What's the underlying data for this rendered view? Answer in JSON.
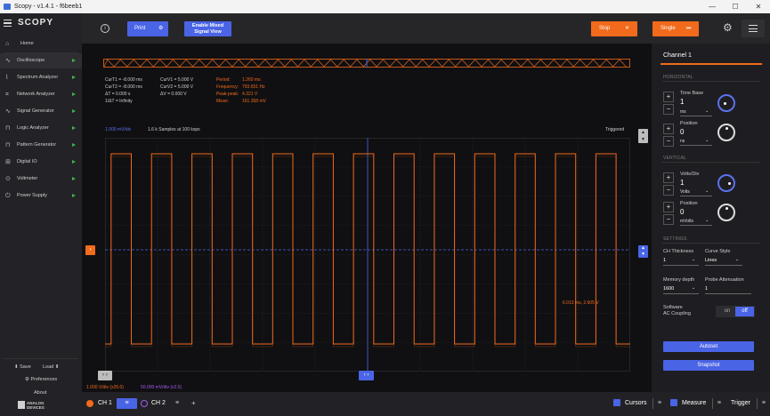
{
  "window": {
    "title": "Scopy - v1.4.1 - f6beeb1",
    "minimize": "—",
    "maximize": "☐",
    "close": "✕"
  },
  "sidebar": {
    "logo": "SCOPY",
    "home": "Home",
    "items": [
      {
        "label": "Oscilloscope",
        "icon": "oscilloscope-icon",
        "running": true
      },
      {
        "label": "Spectrum Analyzer",
        "icon": "spectrum-icon",
        "running": true
      },
      {
        "label": "Network Analyzer",
        "icon": "network-icon",
        "running": true
      },
      {
        "label": "Signal Generator",
        "icon": "signal-generator-icon",
        "running": true
      },
      {
        "label": "Logic Analyzer",
        "icon": "logic-analyzer-icon",
        "running": true
      },
      {
        "label": "Pattern Generator",
        "icon": "pattern-generator-icon",
        "running": true
      },
      {
        "label": "Digital IO",
        "icon": "digital-io-icon",
        "running": true
      },
      {
        "label": "Voltmeter",
        "icon": "voltmeter-icon",
        "running": true
      },
      {
        "label": "Power Supply",
        "icon": "power-supply-icon",
        "running": true
      }
    ],
    "save": "Save",
    "load": "Load",
    "preferences": "Preferences",
    "about": "About",
    "brand": "ANALOG DEVICES"
  },
  "toolbar": {
    "info": "i",
    "print": "Print",
    "mixed_signal": "Enable Mixed Signal View",
    "stop": "Stop",
    "single": "Single"
  },
  "measurements": {
    "cursors_time": [
      "CurT1 = -8.000 ms",
      "CurT2 = -8.000 ms",
      "ΔT = 0.000 s",
      "1/ΔT = Infinity"
    ],
    "cursors_volt": [
      "CurV1 = 5.000 V",
      "CurV2 = 5.000 V",
      "ΔV = 0.000 V"
    ],
    "names": [
      "Period:",
      "Frequency:",
      "Peak-peak:",
      "Mean:"
    ],
    "values": [
      "1.260 ms",
      "793.651 Hz",
      "4.321 V",
      "161.358 mV"
    ]
  },
  "plot": {
    "ch_scale": "1.000 mV/div",
    "samples": "1.6 k Samples at 100 ksps",
    "trigger_status": "Triggered",
    "cursor_readout": "6.013 ms, 2.605 V",
    "ch1_scale_label": "1.000 V/div (x25.0)",
    "ch2_scale_label": "50.000 mV/div (x2.5)",
    "pulses": 13,
    "duty": 0.5,
    "line_color": "#f26a1b",
    "accent_color": "#4a64e6"
  },
  "right": {
    "channel_title": "Channel 1",
    "horizontal": "HORIZONTAL",
    "timebase_label": "Time Base",
    "timebase_value": "1",
    "timebase_unit": "ms",
    "hpos_label": "Position",
    "hpos_value": "0",
    "hpos_unit": "ns",
    "vertical": "VERTICAL",
    "volts_label": "Volts/Div",
    "volts_value": "1",
    "volts_unit": "Volts",
    "vpos_label": "Position",
    "vpos_value": "0",
    "vpos_unit": "mVolts",
    "settings": "SETTINGS",
    "thickness_label": "CH Thickness",
    "thickness_value": "1",
    "curve_label": "Curve Style",
    "curve_value": "Lines",
    "memory_label": "Memory depth",
    "memory_value": "1600",
    "probe_label": "Probe Attenuation",
    "probe_value": "1",
    "ac_label_1": "Software",
    "ac_label_2": "AC Coupling",
    "on": "on",
    "off": "off",
    "autoset": "Autoset",
    "snapshot": "Snapshot"
  },
  "bottom": {
    "ch1": "CH 1",
    "ch2": "CH 2",
    "add": "+",
    "cursors": "Cursors",
    "measure": "Measure",
    "trigger": "Trigger"
  }
}
